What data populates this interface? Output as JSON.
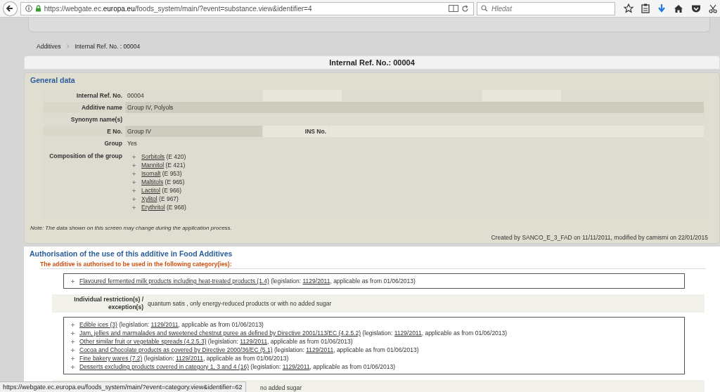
{
  "browser": {
    "url_prefix": "https://webgate.ec.",
    "url_domain": "europa.eu",
    "url_suffix": "/foods_system/main/?event=substance.view&identifier=4",
    "search_placeholder": "Hledat"
  },
  "breadcrumb": [
    "Additives",
    "Internal Ref. No. : 00004"
  ],
  "page_title": "Internal Ref. No.: 00004",
  "general": {
    "title": "General data",
    "internal_ref": {
      "label": "Internal Ref. No.",
      "value": "00004"
    },
    "additive_name": {
      "label": "Additive name",
      "value": "Group IV, Polyols"
    },
    "synonyms": {
      "label": "Synonym name(s)"
    },
    "e_no": {
      "label": "E No.",
      "value": "Group IV",
      "ins_label": "INS No."
    },
    "group": {
      "label": "Group",
      "value": "Yes"
    },
    "composition": {
      "label": "Composition of the group",
      "items": [
        {
          "name": "Sorbitols",
          "code": "(E 420)"
        },
        {
          "name": "Mannitol",
          "code": "(E 421)"
        },
        {
          "name": "Isomalt",
          "code": "(E 953)"
        },
        {
          "name": "Maltitols",
          "code": "(E 965)"
        },
        {
          "name": "Lactitol",
          "code": "(E 966)"
        },
        {
          "name": "Xylitol",
          "code": "(E 967)"
        },
        {
          "name": "Erythritol",
          "code": "(E 968)"
        }
      ]
    },
    "note": "Note: The data shown on this screen may change during the application process.",
    "created": "Created by SANCO_E_3_FAD on 11/11/2011, modified by camismi on 22/01/2015"
  },
  "authorisation": {
    "title": "Authorisation of the use of this additive in Food Additives",
    "subtitle": "The additive is authorised to be used in the following category(ies):",
    "blocks": [
      {
        "categories": [
          {
            "name": "Flavoured fermented milk products including heat-treated products (1.4)",
            "prefix": "(legislation:",
            "legislation": "1129/2011",
            "suffix": ", applicable as from 01/06/2013)"
          }
        ],
        "restriction_label": "Individual restriction(s) / exception(s)",
        "restriction": "quantum satis , only energy-reduced products or with no added sugar"
      },
      {
        "categories": [
          {
            "name": "Edible ices (3)",
            "prefix": "(legislation:",
            "legislation": "1129/2011",
            "suffix": ", applicable as from 01/06/2013)"
          },
          {
            "name": "Jam, jellies and marmalades and sweetened chestnut puree as defined by Directive 2001/113/EC (4.2.5.2)",
            "prefix": "(legislation:",
            "legislation": "1129/2011",
            "suffix": ", applicable as from 01/06/2013)"
          },
          {
            "name": "Other similar fruit or vegetable spreads (4.2.5.3)",
            "prefix": "(legislation:",
            "legislation": "1129/2011",
            "suffix": ", applicable as from 01/06/2013)"
          },
          {
            "name": "Cocoa and Chocolate products as covered by Directive 2000/36/EC (5.1)",
            "prefix": "(legislation:",
            "legislation": "1129/2011",
            "suffix": ", applicable as from 01/06/2013)"
          },
          {
            "name": "Fine bakery wares (7.2)",
            "prefix": "(legislation:",
            "legislation": "1129/2011",
            "suffix": ", applicable as from 01/06/2013)"
          },
          {
            "name": "Desserts excluding products covered in category 1, 3 and 4 (16)",
            "prefix": "(legislation:",
            "legislation": "1129/2011",
            "suffix": ", applicable as from 01/06/2013)"
          }
        ],
        "restriction": "no added sugar"
      }
    ]
  },
  "status_url": "https://webgate.ec.europa.eu/foods_system/main/?event=category.view&identifier=62"
}
